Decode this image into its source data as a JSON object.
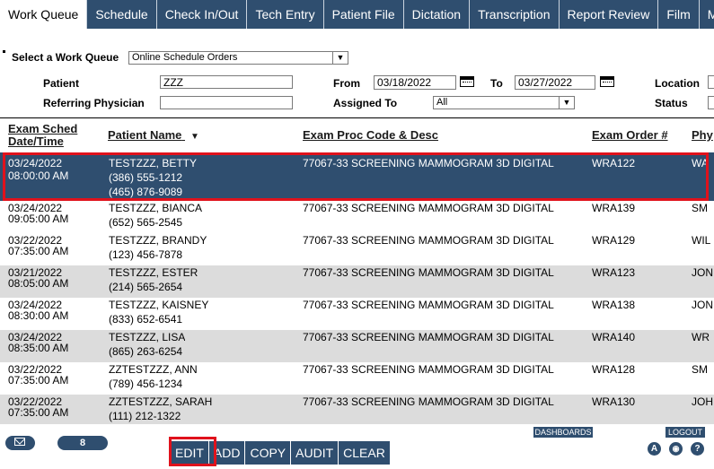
{
  "tabs": [
    "Work Queue",
    "Schedule",
    "Check In/Out",
    "Tech Entry",
    "Patient File",
    "Dictation",
    "Transcription",
    "Report Review",
    "Film",
    "Ma"
  ],
  "filters": {
    "work_queue_label": "Select a Work Queue",
    "work_queue_value": "Online Schedule Orders",
    "patient_label": "Patient",
    "patient_value": "ZZZ",
    "referring_label": "Referring Physician",
    "referring_value": "",
    "from_label": "From",
    "from_value": "03/18/2022",
    "to_label": "To",
    "to_value": "03/27/2022",
    "assigned_label": "Assigned To",
    "assigned_value": "All",
    "location_label": "Location",
    "status_label": "Status"
  },
  "columns": {
    "sched_line1": "Exam Sched",
    "sched_line2": "Date/Time",
    "patient": "Patient Name",
    "proc": "Exam Proc Code & Desc",
    "order": "Exam Order #",
    "phys": "Phy"
  },
  "rows": [
    {
      "date": "03/24/2022",
      "time": "08:00:00 AM",
      "name": "TESTZZZ, BETTY",
      "phone1": "(386) 555-1212",
      "phone2": "(465) 876-9089",
      "proc": "77067-33 SCREENING MAMMOGRAM 3D DIGITAL",
      "order": "WRA122",
      "phys": "WA"
    },
    {
      "date": "03/24/2022",
      "time": "09:05:00 AM",
      "name": "TESTZZZ, BIANCA",
      "phone1": "(652) 565-2545",
      "proc": "77067-33 SCREENING MAMMOGRAM 3D DIGITAL",
      "order": "WRA139",
      "phys": "SM"
    },
    {
      "date": "03/22/2022",
      "time": "07:35:00 AM",
      "name": "TESTZZZ, BRANDY",
      "phone1": "(123) 456-7878",
      "proc": "77067-33 SCREENING MAMMOGRAM 3D DIGITAL",
      "order": "WRA129",
      "phys": "WIL"
    },
    {
      "date": "03/21/2022",
      "time": "08:05:00 AM",
      "name": "TESTZZZ, ESTER",
      "phone1": "(214) 565-2654",
      "proc": "77067-33 SCREENING MAMMOGRAM 3D DIGITAL",
      "order": "WRA123",
      "phys": "JON"
    },
    {
      "date": "03/24/2022",
      "time": "08:30:00 AM",
      "name": "TESTZZZ, KAISNEY",
      "phone1": "(833) 652-6541",
      "proc": "77067-33 SCREENING MAMMOGRAM 3D DIGITAL",
      "order": "WRA138",
      "phys": "JON"
    },
    {
      "date": "03/24/2022",
      "time": "08:35:00 AM",
      "name": "TESTZZZ, LISA",
      "phone1": "(865) 263-6254",
      "proc": "77067-33 SCREENING MAMMOGRAM 3D DIGITAL",
      "order": "WRA140",
      "phys": "WR"
    },
    {
      "date": "03/22/2022",
      "time": "07:35:00 AM",
      "name": "ZZTESTZZZ, ANN",
      "phone1": "(789) 456-1234",
      "proc": "77067-33 SCREENING MAMMOGRAM 3D DIGITAL",
      "order": "WRA128",
      "phys": "SM"
    },
    {
      "date": "03/22/2022",
      "time": "07:35:00 AM",
      "name": "ZZTESTZZZ, SARAH",
      "phone1": "(111) 212-1322",
      "proc": "77067-33 SCREENING MAMMOGRAM 3D DIGITAL",
      "order": "WRA130",
      "phys": "JOH"
    }
  ],
  "footer": {
    "message_count": "8",
    "dashboards": "DASHBOARDS",
    "logout": "LOGOUT",
    "buttons": [
      "EDIT",
      "ADD",
      "COPY",
      "AUDIT",
      "CLEAR"
    ],
    "icon_a": "A",
    "icon_help": "?"
  }
}
